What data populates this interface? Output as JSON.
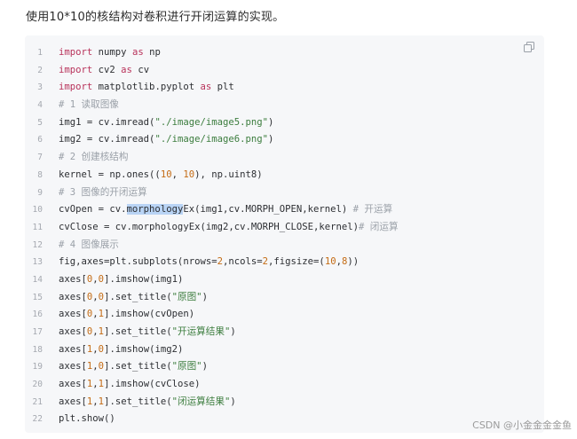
{
  "intro_text": "使用10*10的核结构对卷积进行开闭运算的实现。",
  "code": {
    "line_numbers": [
      "1",
      "2",
      "3",
      "4",
      "5",
      "6",
      "7",
      "8",
      "9",
      "10",
      "11",
      "12",
      "13",
      "14",
      "15",
      "16",
      "17",
      "18",
      "19",
      "20",
      "21",
      "22"
    ],
    "lines": [
      [
        {
          "t": "kw",
          "v": "import"
        },
        {
          "t": "p",
          "v": " numpy "
        },
        {
          "t": "kw",
          "v": "as"
        },
        {
          "t": "p",
          "v": " np"
        }
      ],
      [
        {
          "t": "kw",
          "v": "import"
        },
        {
          "t": "p",
          "v": " cv2 "
        },
        {
          "t": "kw",
          "v": "as"
        },
        {
          "t": "p",
          "v": " cv"
        }
      ],
      [
        {
          "t": "kw",
          "v": "import"
        },
        {
          "t": "p",
          "v": " matplotlib.pyplot "
        },
        {
          "t": "kw",
          "v": "as"
        },
        {
          "t": "p",
          "v": " plt"
        }
      ],
      [
        {
          "t": "cm",
          "v": "# 1 读取图像"
        }
      ],
      [
        {
          "t": "p",
          "v": "img1 = cv.imread("
        },
        {
          "t": "st",
          "v": "\"./image/image5.png\""
        },
        {
          "t": "p",
          "v": ")"
        }
      ],
      [
        {
          "t": "p",
          "v": "img2 = cv.imread("
        },
        {
          "t": "st",
          "v": "\"./image/image6.png\""
        },
        {
          "t": "p",
          "v": ")"
        }
      ],
      [
        {
          "t": "cm",
          "v": "# 2 创建核结构"
        }
      ],
      [
        {
          "t": "p",
          "v": "kernel = np.ones(("
        },
        {
          "t": "num",
          "v": "10"
        },
        {
          "t": "p",
          "v": ", "
        },
        {
          "t": "num",
          "v": "10"
        },
        {
          "t": "p",
          "v": "), np.uint8)"
        }
      ],
      [
        {
          "t": "cm",
          "v": "# 3 图像的开闭运算"
        }
      ],
      [
        {
          "t": "p",
          "v": "cvOpen = cv."
        },
        {
          "t": "hl",
          "v": "morphology"
        },
        {
          "t": "p",
          "v": "Ex(img1,cv.MORPH_OPEN,kernel) "
        },
        {
          "t": "cm",
          "v": "# 开运算"
        }
      ],
      [
        {
          "t": "p",
          "v": "cvClose = cv.morphologyEx(img2,cv.MORPH_CLOSE,kernel)"
        },
        {
          "t": "cm",
          "v": "# 闭运算"
        }
      ],
      [
        {
          "t": "cm",
          "v": "# 4 图像展示"
        }
      ],
      [
        {
          "t": "p",
          "v": "fig,axes=plt.subplots(nrows="
        },
        {
          "t": "num",
          "v": "2"
        },
        {
          "t": "p",
          "v": ",ncols="
        },
        {
          "t": "num",
          "v": "2"
        },
        {
          "t": "p",
          "v": ",figsize=("
        },
        {
          "t": "num",
          "v": "10"
        },
        {
          "t": "p",
          "v": ","
        },
        {
          "t": "num",
          "v": "8"
        },
        {
          "t": "p",
          "v": "))"
        }
      ],
      [
        {
          "t": "p",
          "v": "axes["
        },
        {
          "t": "num",
          "v": "0"
        },
        {
          "t": "p",
          "v": ","
        },
        {
          "t": "num",
          "v": "0"
        },
        {
          "t": "p",
          "v": "].imshow(img1)"
        }
      ],
      [
        {
          "t": "p",
          "v": "axes["
        },
        {
          "t": "num",
          "v": "0"
        },
        {
          "t": "p",
          "v": ","
        },
        {
          "t": "num",
          "v": "0"
        },
        {
          "t": "p",
          "v": "].set_title("
        },
        {
          "t": "st",
          "v": "\"原图\""
        },
        {
          "t": "p",
          "v": ")"
        }
      ],
      [
        {
          "t": "p",
          "v": "axes["
        },
        {
          "t": "num",
          "v": "0"
        },
        {
          "t": "p",
          "v": ","
        },
        {
          "t": "num",
          "v": "1"
        },
        {
          "t": "p",
          "v": "].imshow(cvOpen)"
        }
      ],
      [
        {
          "t": "p",
          "v": "axes["
        },
        {
          "t": "num",
          "v": "0"
        },
        {
          "t": "p",
          "v": ","
        },
        {
          "t": "num",
          "v": "1"
        },
        {
          "t": "p",
          "v": "].set_title("
        },
        {
          "t": "st",
          "v": "\"开运算结果\""
        },
        {
          "t": "p",
          "v": ")"
        }
      ],
      [
        {
          "t": "p",
          "v": "axes["
        },
        {
          "t": "num",
          "v": "1"
        },
        {
          "t": "p",
          "v": ","
        },
        {
          "t": "num",
          "v": "0"
        },
        {
          "t": "p",
          "v": "].imshow(img2)"
        }
      ],
      [
        {
          "t": "p",
          "v": "axes["
        },
        {
          "t": "num",
          "v": "1"
        },
        {
          "t": "p",
          "v": ","
        },
        {
          "t": "num",
          "v": "0"
        },
        {
          "t": "p",
          "v": "].set_title("
        },
        {
          "t": "st",
          "v": "\"原图\""
        },
        {
          "t": "p",
          "v": ")"
        }
      ],
      [
        {
          "t": "p",
          "v": "axes["
        },
        {
          "t": "num",
          "v": "1"
        },
        {
          "t": "p",
          "v": ","
        },
        {
          "t": "num",
          "v": "1"
        },
        {
          "t": "p",
          "v": "].imshow(cvClose)"
        }
      ],
      [
        {
          "t": "p",
          "v": "axes["
        },
        {
          "t": "num",
          "v": "1"
        },
        {
          "t": "p",
          "v": ","
        },
        {
          "t": "num",
          "v": "1"
        },
        {
          "t": "p",
          "v": "].set_title("
        },
        {
          "t": "st",
          "v": "\"闭运算结果\""
        },
        {
          "t": "p",
          "v": ")"
        }
      ],
      [
        {
          "t": "p",
          "v": "plt.show()"
        }
      ]
    ]
  },
  "copy_icon": "copy-icon",
  "watermark": "CSDN @小金金金金鱼",
  "colors": {
    "background": "#ffffff",
    "code_background": "#f6f7f9",
    "selection": "#b9d4f5"
  }
}
